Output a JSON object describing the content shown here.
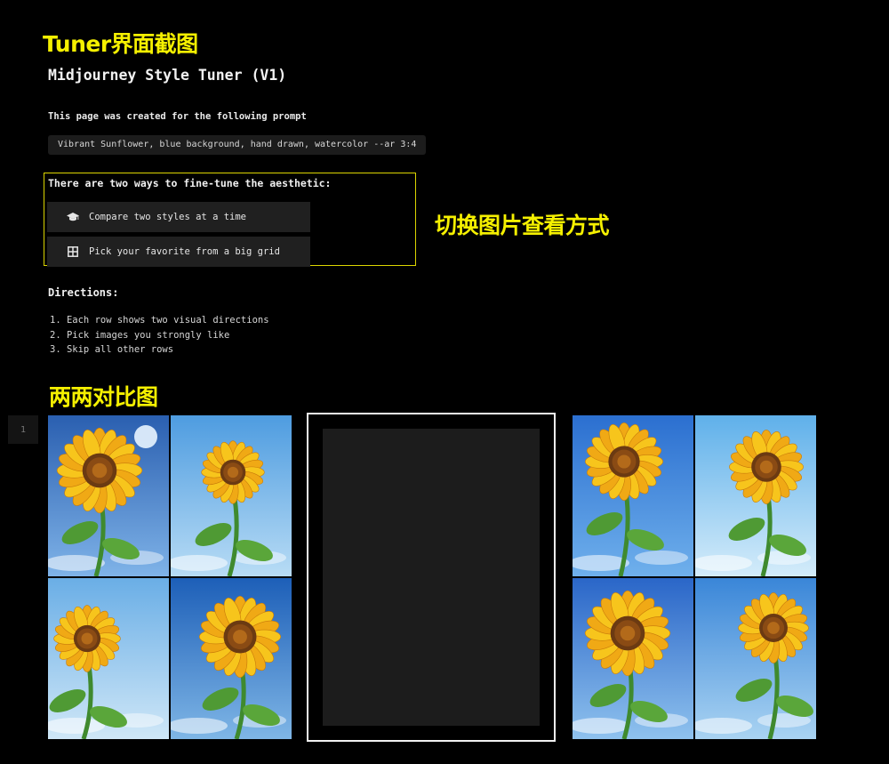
{
  "annotations": {
    "tuner_screenshot": "Tuner界面截图",
    "switch_view": "切换图片查看方式",
    "pairwise": "两两对比图"
  },
  "page": {
    "title": "Midjourney Style Tuner (V1)",
    "prompt_intro": "This page was created for the following prompt",
    "prompt": "Vibrant Sunflower, blue background, hand drawn, watercolor --ar 3:4"
  },
  "modes": {
    "heading": "There are two ways to fine-tune the aesthetic:",
    "compare_label": "Compare two styles at a time",
    "compare_icon": "graduation-cap-icon",
    "grid_label": "Pick your favorite from a big grid",
    "grid_icon": "grid-icon"
  },
  "directions": {
    "heading": "Directions:",
    "items": [
      "1. Each row shows two visual directions",
      "2. Pick images you strongly like",
      "3. Skip all other rows"
    ]
  },
  "row": {
    "number": "1"
  },
  "colors": {
    "annotation": "#f5f000",
    "panel_border": "#dcd500",
    "background": "#000000",
    "button_bg": "#202020",
    "sky_blue": "#3d8fd8",
    "petal_yellow": "#f7c51c",
    "seed_brown": "#6b3a12"
  }
}
